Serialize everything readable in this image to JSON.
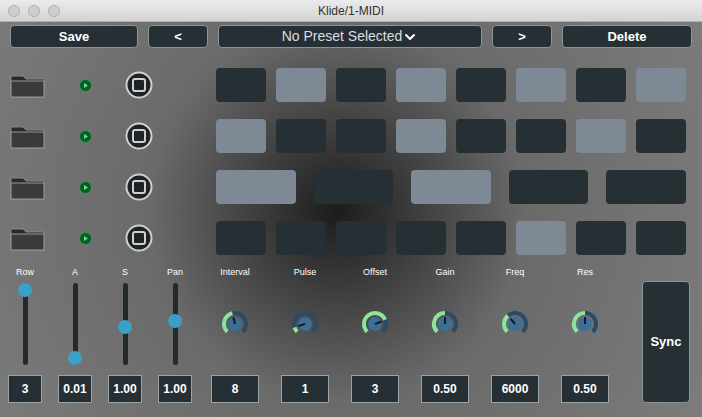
{
  "window": {
    "title": "Klide/1-MIDI"
  },
  "toolbar": {
    "save": "Save",
    "prev": "<",
    "preset": "No Preset Selected",
    "next": ">",
    "delete": "Delete"
  },
  "rows": [
    {
      "steps": [
        {
          "on": false
        },
        {
          "on": true
        },
        {
          "on": false
        },
        {
          "on": true
        },
        {
          "on": false
        },
        {
          "on": true
        },
        {
          "on": false
        },
        {
          "on": true
        }
      ]
    },
    {
      "steps": [
        {
          "on": true
        },
        {
          "on": false
        },
        {
          "on": false
        },
        {
          "on": true
        },
        {
          "on": false
        },
        {
          "on": false
        },
        {
          "on": true
        },
        {
          "on": false
        }
      ]
    },
    {
      "steps": [
        {
          "on": true
        },
        {
          "on": false
        },
        {
          "on": true
        },
        {
          "on": false
        },
        {
          "on": false
        }
      ]
    },
    {
      "steps": [
        {
          "on": false
        },
        {
          "on": false
        },
        {
          "on": false
        },
        {
          "on": false
        },
        {
          "on": false
        },
        {
          "on": true
        },
        {
          "on": false
        },
        {
          "on": false
        }
      ]
    }
  ],
  "sliders": [
    {
      "label": "Row",
      "value": "3",
      "level": 1
    },
    {
      "label": "A",
      "value": "0.01",
      "level": 0
    },
    {
      "label": "S",
      "value": "1.00",
      "level": 0.45
    },
    {
      "label": "Pan",
      "value": "1.00",
      "level": 0.55
    }
  ],
  "knobs": [
    {
      "label": "Interval",
      "value": "8",
      "level": 0.45
    },
    {
      "label": "Pulse",
      "value": "1",
      "level": 0.1
    },
    {
      "label": "Offset",
      "value": "3",
      "level": 0.75
    },
    {
      "label": "Gain",
      "value": "0.50",
      "level": 0.5
    },
    {
      "label": "Freq",
      "value": "6000",
      "level": 0.35
    },
    {
      "label": "Res",
      "value": "0.50",
      "level": 0.5
    }
  ],
  "sync": {
    "label": "Sync"
  }
}
